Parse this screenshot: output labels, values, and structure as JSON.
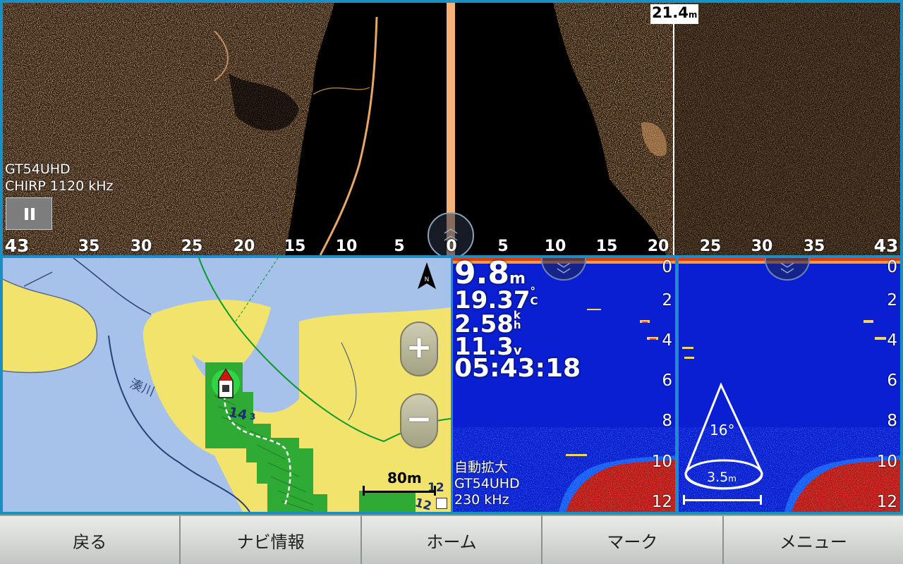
{
  "sidescan": {
    "transducer": "GT54UHD",
    "frequency": "CHIRP 1120 kHz",
    "cursor_range_value": "21.4",
    "cursor_range_unit": "m",
    "range_ticks_left": [
      "43",
      "35",
      "30",
      "25",
      "20",
      "15",
      "10",
      "5"
    ],
    "range_tick_center": "0",
    "range_ticks_right": [
      "5",
      "10",
      "15",
      "20",
      "25",
      "30",
      "35",
      "43"
    ]
  },
  "chart": {
    "river_name": "湊川",
    "scale_label": "80m",
    "depth_labels": [
      "14",
      "3",
      "12",
      "12"
    ],
    "zoom_in": "+",
    "zoom_out": "−",
    "north_label": "N"
  },
  "sonar_left": {
    "depth": "9.8",
    "depth_unit": "m",
    "water_temp": "19.37",
    "temp_unit_top": "°",
    "temp_unit_bottom": "C",
    "speed": "2.58",
    "speed_unit_top": "k",
    "speed_unit_bottom": "h",
    "voltage": "11.3",
    "voltage_unit": "v",
    "time": "05:43:18",
    "mode": "自動拡大",
    "transducer": "GT54UHD",
    "frequency": "230 kHz",
    "depth_scale": [
      "0",
      "2",
      "4",
      "6",
      "8",
      "10",
      "12"
    ]
  },
  "sonar_right": {
    "cone_angle": "16°",
    "cone_width": "3.5",
    "cone_width_unit": "m",
    "depth_scale": [
      "0",
      "2",
      "4",
      "6",
      "8",
      "10",
      "12"
    ]
  },
  "softkeys": [
    "戻る",
    "ナビ情報",
    "ホーム",
    "マーク",
    "メニュー"
  ],
  "colors": {
    "frame": "#1a8fc4",
    "sonar_bg": "#0a1fd2",
    "bottom_return": "#c21810",
    "land": "#f1e36c",
    "water": "#a7c2ea",
    "shallow": "#2faa35"
  }
}
